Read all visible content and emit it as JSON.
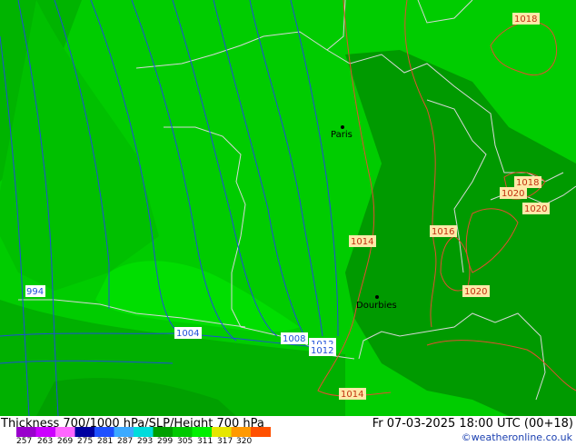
{
  "map": {
    "cities": [
      {
        "name": "Paris"
      },
      {
        "name": "Dourbies"
      }
    ],
    "isobars": {
      "blue": [
        "994",
        "1004",
        "1008",
        "1012",
        "1012"
      ],
      "red": [
        "1018",
        "1018",
        "1020",
        "1020",
        "1016",
        "1014",
        "1020",
        "1014"
      ]
    },
    "colors": {
      "bright_green": "#00cc00",
      "mid_green": "#00b000",
      "dark_green": "#009600",
      "light_green": "#00e000",
      "isobar_blue": "#1e4fd8",
      "isobar_red": "#e05030",
      "border": "#d8d8d8"
    }
  },
  "footer": {
    "title": "Thickness 700/1000 hPa/SLP/Height 700 hPa",
    "datetime": "Fr 07-03-2025 18:00 UTC (00+18)",
    "credit": "©weatheronline.co.uk"
  },
  "legend": {
    "ticks": [
      "257",
      "263",
      "269",
      "275",
      "281",
      "287",
      "293",
      "299",
      "305",
      "311",
      "317",
      "320"
    ],
    "colors": [
      "#9900cc",
      "#cc00ff",
      "#ff66ff",
      "#0000a0",
      "#1e50ff",
      "#3caaff",
      "#00dcdc",
      "#00a000",
      "#00c800",
      "#00f000",
      "#e6e600",
      "#ff9900",
      "#ff5000"
    ]
  }
}
